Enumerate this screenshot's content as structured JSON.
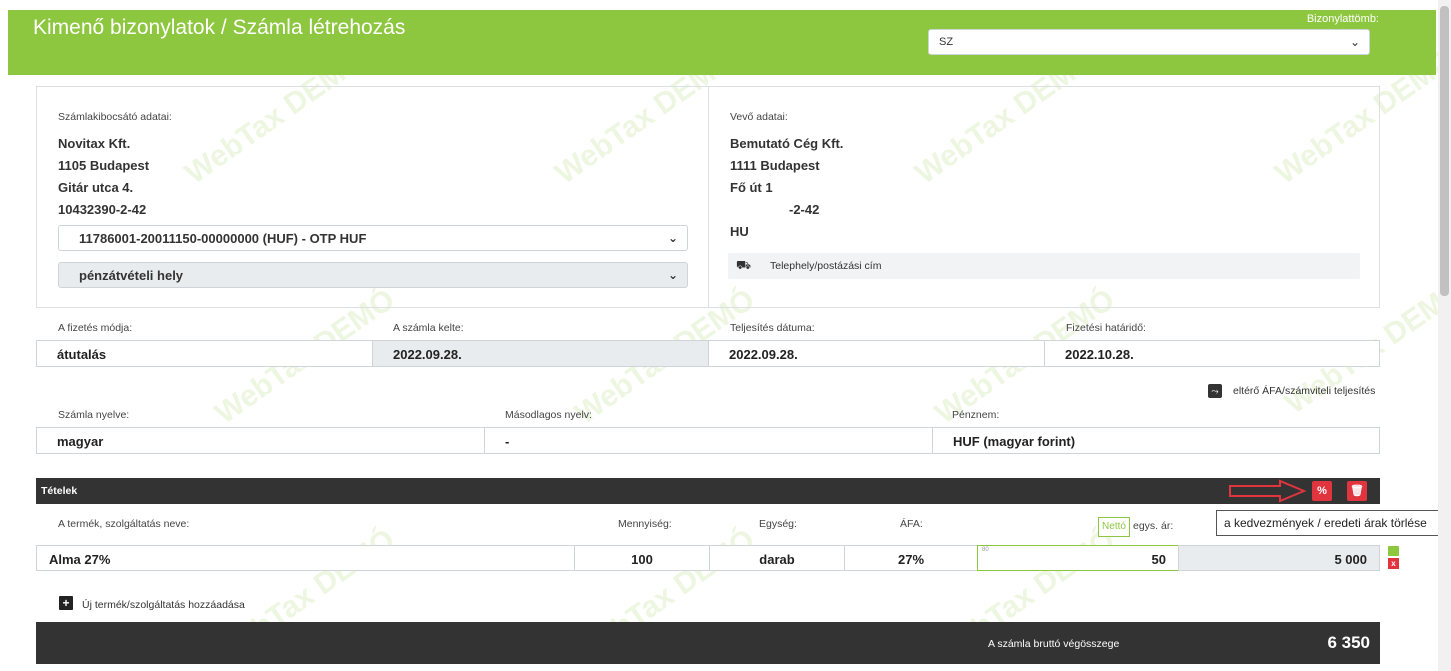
{
  "header": {
    "title": "Kimenő bizonylatok / Számla létrehozás",
    "block_label": "Bizonylattömb:",
    "block_value": "SZ"
  },
  "seller": {
    "label": "Számlakibocsátó adatai:",
    "lines": [
      "Novitax Kft.",
      "1105 Budapest",
      "Gitár utca 4.",
      "10432390-2-42"
    ],
    "bank_account": "11786001-20011150-00000000 (HUF) - OTP HUF",
    "cash_place": "pénzátvételi hely"
  },
  "buyer": {
    "label": "Vevő adatai:",
    "lines": [
      "Bemutató Cég Kft.",
      "1111 Budapest",
      "Fő út 1",
      "-2-42",
      "HU"
    ],
    "site_button": "Telephely/postázási cím"
  },
  "payment": {
    "method_label": "A fizetés módja:",
    "method_value": "átutalás",
    "issue_label": "A számla kelte:",
    "issue_value": "2022.09.28.",
    "fulfil_label": "Teljesítés dátuma:",
    "fulfil_value": "2022.09.28.",
    "due_label": "Fizetési határidő:",
    "due_value": "2022.10.28."
  },
  "vat_toggle_label": "eltérő ÁFA/számviteli teljesítés",
  "language": {
    "label": "Számla nyelve:",
    "value": "magyar",
    "second_label": "Másodlagos nyelv:",
    "second_value": "-",
    "currency_label": "Pénznem:",
    "currency_value": "HUF (magyar forint)"
  },
  "items": {
    "title": "Tételek",
    "tooltip": "a kedvezmények / eredeti árak törlése",
    "col_name": "A termék, szolgáltatás neve:",
    "col_qty": "Mennyiség:",
    "col_unit": "Egység:",
    "col_vat": "ÁFA:",
    "netto_btn": "Nettó",
    "col_price": "egys. ár:",
    "row": {
      "name": "Alma 27%",
      "qty": "100",
      "unit": "darab",
      "vat": "27%",
      "price_hint": "80",
      "price": "50",
      "total": "5 000"
    },
    "add_label": "Új termék/szolgáltatás hozzáadása"
  },
  "total": {
    "label": "A számla bruttó végösszege",
    "value": "6 350"
  },
  "watermark": "WebTax DEMÓ",
  "colors": {
    "brand": "#8dc63f",
    "dark_bar": "#333333",
    "danger": "#e0343f"
  }
}
